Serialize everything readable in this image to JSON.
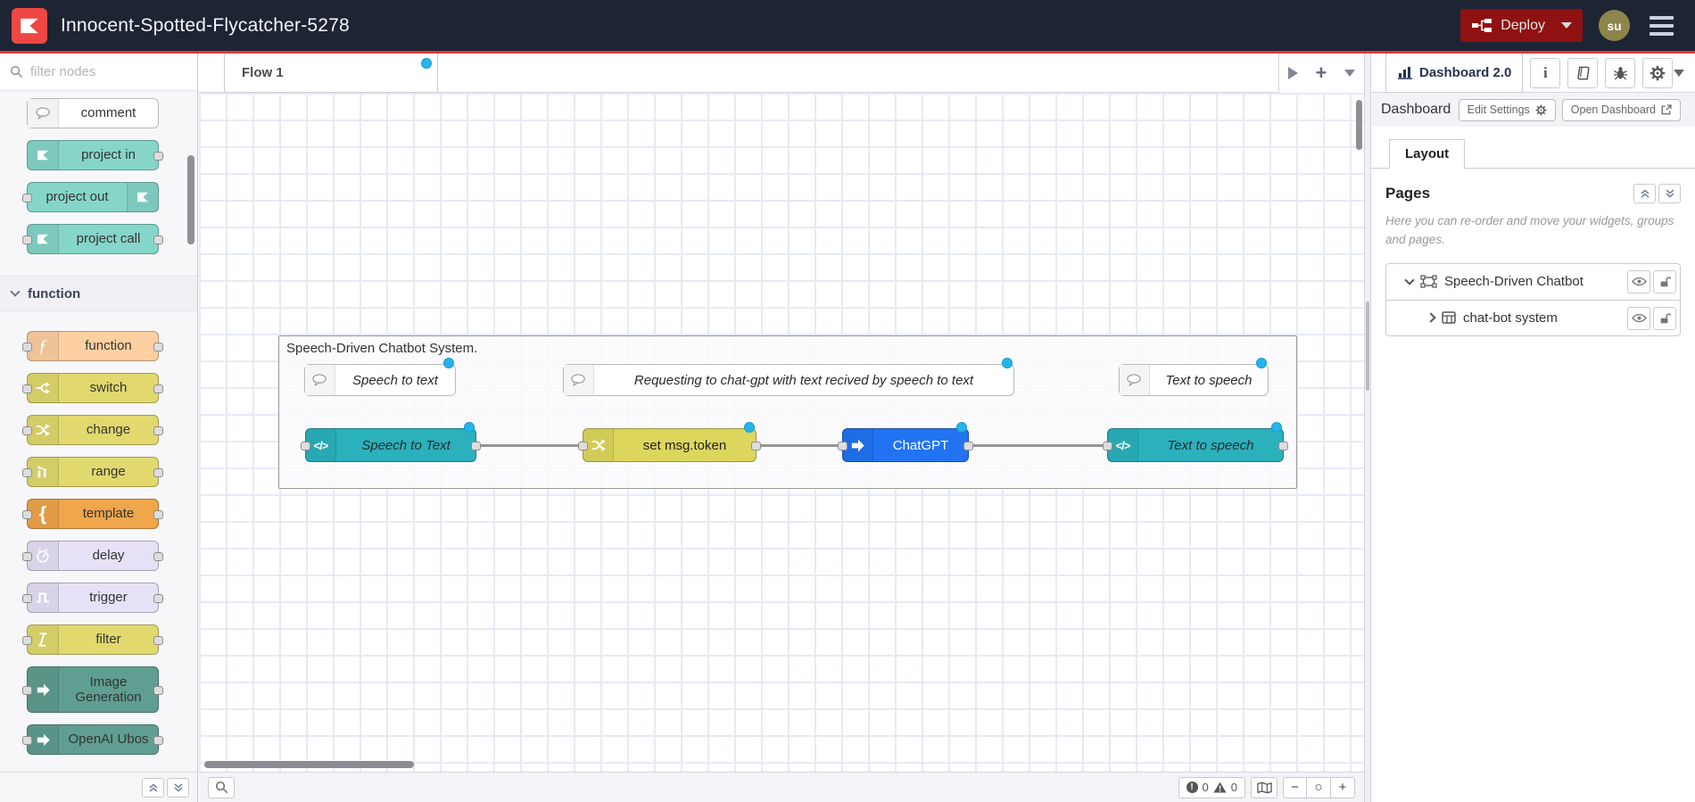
{
  "header": {
    "title": "Innocent-Spotted-Flycatcher-5278",
    "deploy_label": "Deploy",
    "avatar_initials": "su"
  },
  "palette": {
    "search_placeholder": "filter nodes",
    "category_label": "function",
    "nodes": [
      {
        "label": "comment",
        "color": "#ffffff"
      },
      {
        "label": "project in",
        "color": "#85d6c9"
      },
      {
        "label": "project out",
        "color": "#85d6c9"
      },
      {
        "label": "project call",
        "color": "#85d6c9"
      },
      {
        "label": "function",
        "color": "#fdd0a2"
      },
      {
        "label": "switch",
        "color": "#e2d96e"
      },
      {
        "label": "change",
        "color": "#e2d96e"
      },
      {
        "label": "range",
        "color": "#e2d96e"
      },
      {
        "label": "template",
        "color": "#f0a64a"
      },
      {
        "label": "delay",
        "color": "#e6e1f7"
      },
      {
        "label": "trigger",
        "color": "#e6e1f7"
      },
      {
        "label": "filter",
        "color": "#e2d96e"
      },
      {
        "label": "Image Generation",
        "color": "#5f9e90"
      },
      {
        "label": "OpenAI Ubos",
        "color": "#5f9e90"
      }
    ]
  },
  "workspace": {
    "flow_tab_label": "Flow 1"
  },
  "canvas": {
    "group_title": "Speech-Driven Chatbot System.",
    "comments": [
      {
        "label": "Speech to text"
      },
      {
        "label": "Requesting to chat-gpt with text recived by speech to text"
      },
      {
        "label": "Text to speech"
      }
    ],
    "nodes": [
      {
        "label": "Speech to Text",
        "color": "#2bb1bc"
      },
      {
        "label": "set msg.token",
        "color": "#ddd65d"
      },
      {
        "label": "ChatGPT",
        "color": "#2173f2"
      },
      {
        "label": "Text to speech",
        "color": "#2bb1bc"
      }
    ]
  },
  "footer": {
    "error_count": "0",
    "warning_count": "0",
    "zoom_out": "−",
    "zoom_reset": "○",
    "zoom_in": "+"
  },
  "sidebar": {
    "active_tab": "Dashboard 2.0",
    "section_title": "Dashboard",
    "edit_settings_label": "Edit Settings",
    "open_dashboard_label": "Open Dashboard",
    "layout_tab_label": "Layout",
    "pages_title": "Pages",
    "pages_description": "Here you can re-order and move your widgets, groups and pages.",
    "items": [
      {
        "label": "Speech-Driven Chatbot S"
      },
      {
        "label": "chat-bot system"
      }
    ]
  },
  "colors": {
    "header_bg": "#1d2433",
    "accent_red": "#db3b3b",
    "logo_red": "#ee4744",
    "deploy_bg": "#8f1111",
    "avatar_bg": "#8d854c",
    "changed_dot": "#27b3e8",
    "wire": "#949494"
  },
  "icons": {
    "logo": "flowfuse-mark",
    "menu": "hamburger",
    "deploy": "flow-deploy",
    "search": "magnifier",
    "comment": "speech-bubble",
    "function": "ƒ",
    "code": "</>",
    "info": "i",
    "docs": "book",
    "debug": "bug",
    "config": "gear",
    "eye": "visibility",
    "lock": "unlocked",
    "map": "navigator"
  }
}
